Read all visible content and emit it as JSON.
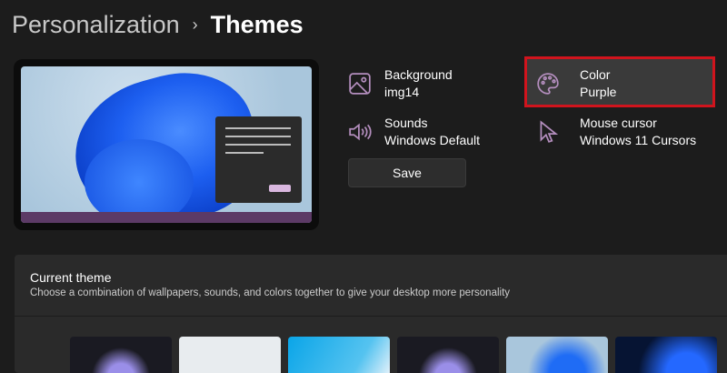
{
  "breadcrumb": {
    "parent": "Personalization",
    "separator": "›",
    "current": "Themes"
  },
  "settings": {
    "background": {
      "label": "Background",
      "value": "img14"
    },
    "color": {
      "label": "Color",
      "value": "Purple"
    },
    "sounds": {
      "label": "Sounds",
      "value": "Windows Default"
    },
    "mouse_cursor": {
      "label": "Mouse cursor",
      "value": "Windows 11 Cursors"
    }
  },
  "save_label": "Save",
  "current_theme": {
    "title": "Current theme",
    "description": "Choose a combination of wallpapers, sounds, and colors together to give your desktop more personality"
  },
  "colors": {
    "accent": "#b48ebe",
    "highlight": "#d0141d",
    "taskbar": "#5c3a66"
  }
}
